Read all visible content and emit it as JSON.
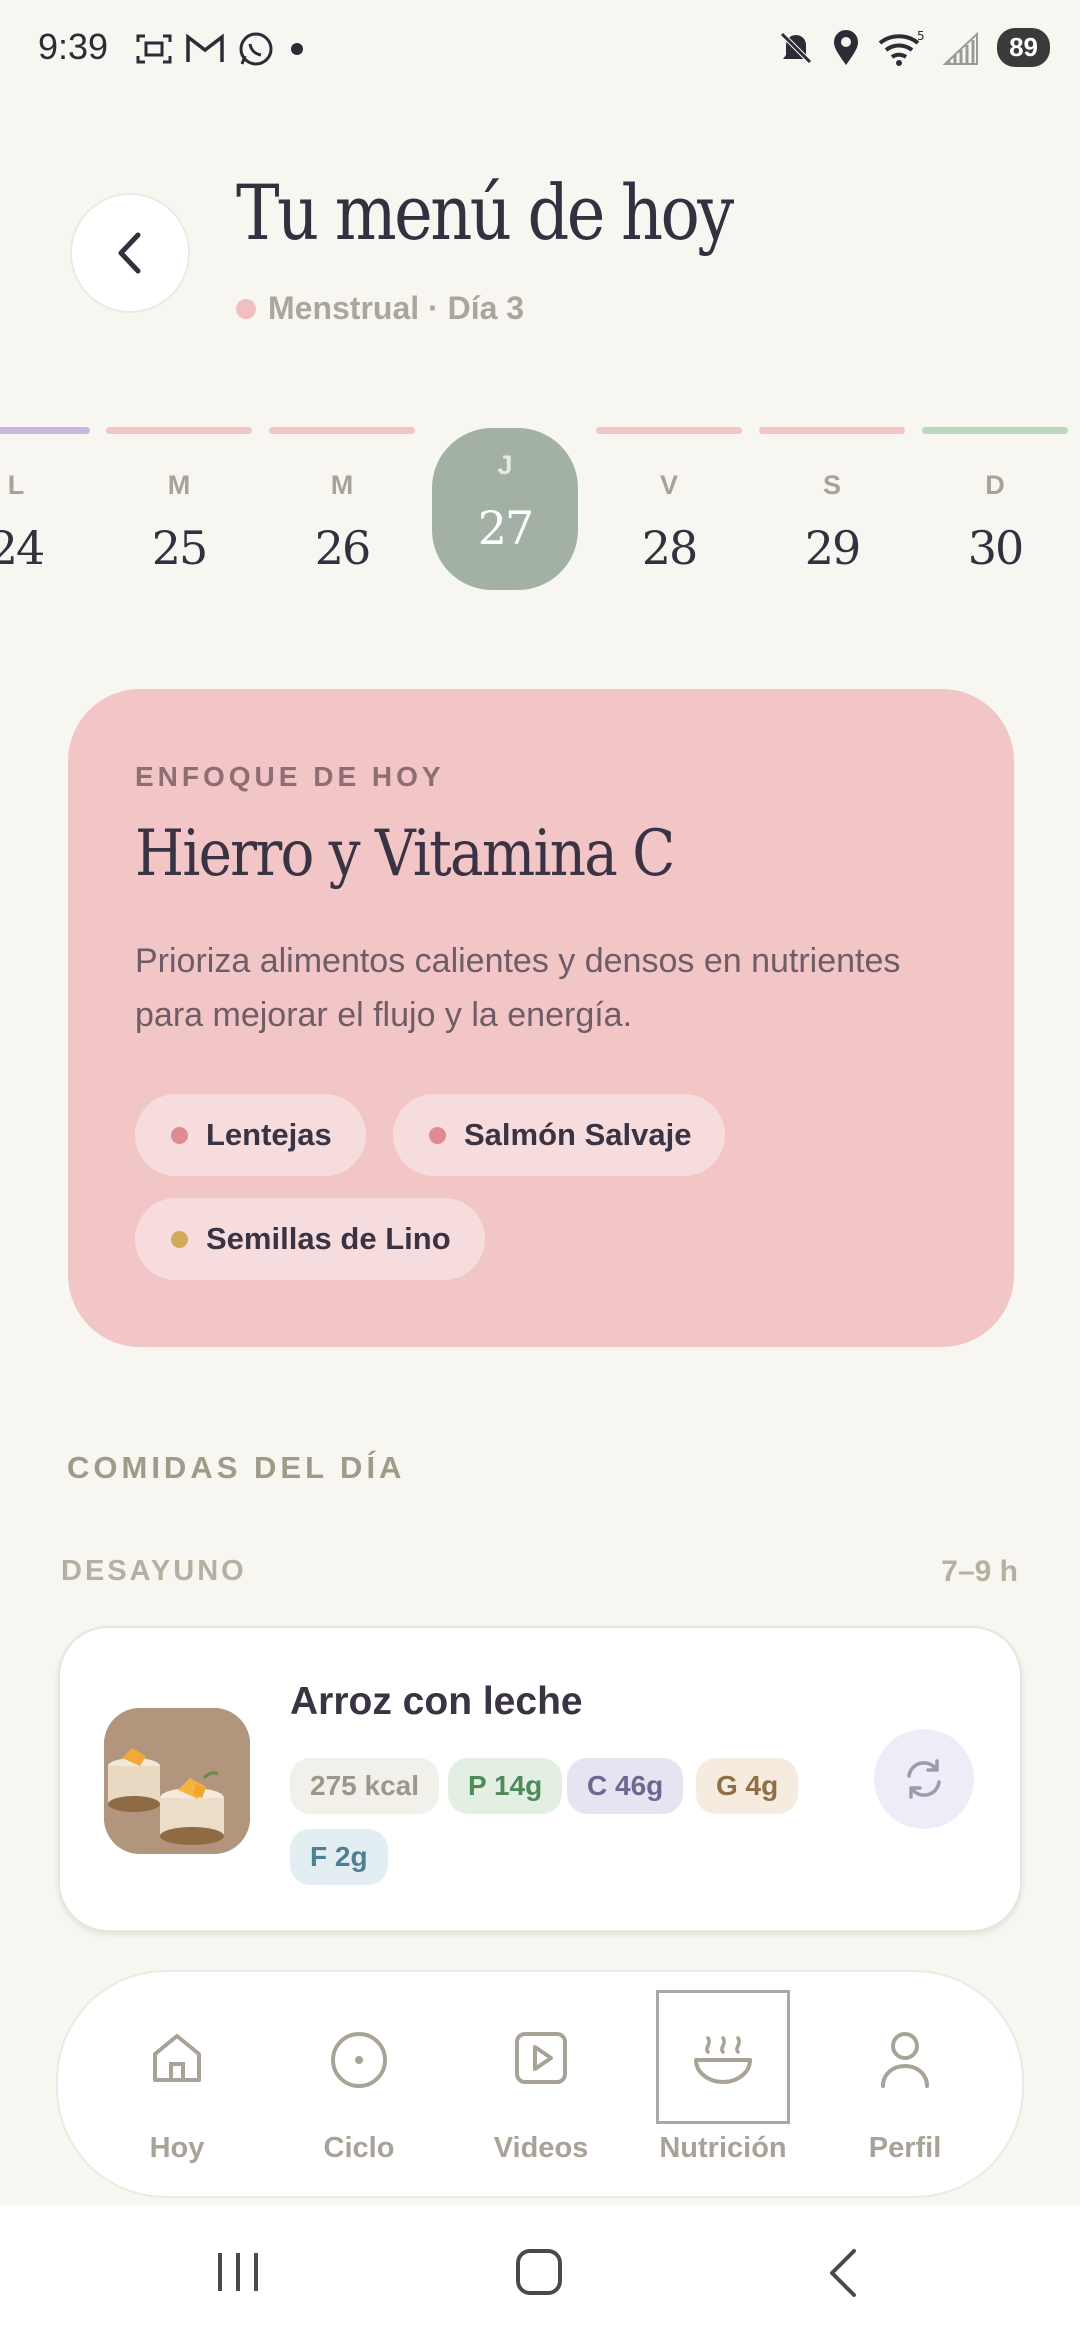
{
  "status_bar": {
    "time": "9:39",
    "battery": "89",
    "left_icons": [
      "screenshot-icon",
      "gmail-icon",
      "whatsapp-icon",
      "dot-icon"
    ],
    "right_icons": [
      "mute-icon",
      "location-icon",
      "wifi-icon",
      "signal-icon"
    ]
  },
  "header": {
    "title": "Tu menú de hoy",
    "phase": "Menstrual · Día 3",
    "phase_color": "#F0BFC4"
  },
  "days": [
    {
      "letter": "L",
      "number": "24",
      "color": "#C9B8DD"
    },
    {
      "letter": "M",
      "number": "25",
      "color": "#F2C5C6"
    },
    {
      "letter": "M",
      "number": "26",
      "color": "#F2C5C6"
    },
    {
      "letter": "J",
      "number": "27",
      "color": "#A3B1A4",
      "selected": true
    },
    {
      "letter": "V",
      "number": "28",
      "color": "#F2C5C6"
    },
    {
      "letter": "S",
      "number": "29",
      "color": "#F2C5C6"
    },
    {
      "letter": "D",
      "number": "30",
      "color": "#BCD9C0"
    }
  ],
  "focus": {
    "eyebrow": "ENFOQUE DE HOY",
    "title": "Hierro y Vitamina C",
    "description": "Prioriza alimentos calientes y densos en nutrientes para mejorar el flujo y la energía.",
    "chips": [
      {
        "label": "Lentejas",
        "dot_color": "#E08A92"
      },
      {
        "label": "Salmón Salvaje",
        "dot_color": "#E08A92"
      },
      {
        "label": "Semillas de Lino",
        "dot_color": "#D4A955"
      }
    ]
  },
  "meals": {
    "section_title": "COMIDAS DEL DÍA",
    "breakfast": {
      "label": "DESAYUNO",
      "time": "7–9 h",
      "name": "Arroz con leche",
      "kcal": "275 kcal",
      "protein": "P 14g",
      "carbs": "C 46g",
      "fat": "G 4g",
      "fiber": "F 2g"
    }
  },
  "nav": {
    "items": [
      {
        "label": "Hoy",
        "icon": "home-icon"
      },
      {
        "label": "Ciclo",
        "icon": "cycle-icon"
      },
      {
        "label": "Videos",
        "icon": "video-icon"
      },
      {
        "label": "Nutrición",
        "icon": "bowl-icon",
        "active": true
      },
      {
        "label": "Perfil",
        "icon": "profile-icon"
      }
    ]
  }
}
